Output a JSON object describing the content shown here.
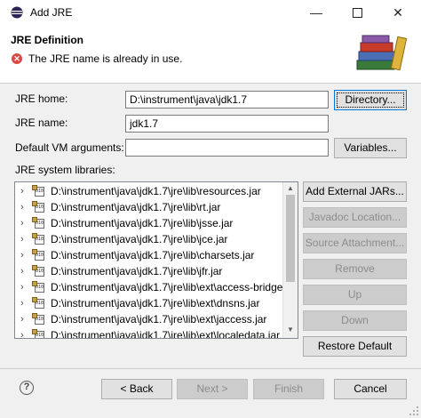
{
  "window": {
    "title": "Add JRE",
    "minimize_glyph": "—",
    "close_glyph": "✕"
  },
  "header": {
    "title": "JRE Definition",
    "message": "The JRE name is already in use.",
    "message_icon": "error-icon",
    "message_icon_glyph": "✕"
  },
  "form": {
    "jre_home_label": "JRE home:",
    "jre_home_value": "D:\\instrument\\java\\jdk1.7",
    "directory_button": "Directory...",
    "jre_name_label": "JRE name:",
    "jre_name_value": "jdk1.7",
    "vm_args_label": "Default VM arguments:",
    "vm_args_value": "",
    "variables_button": "Variables...",
    "libraries_label": "JRE system libraries:"
  },
  "libraries": {
    "items": [
      "D:\\instrument\\java\\jdk1.7\\jre\\lib\\resources.jar",
      "D:\\instrument\\java\\jdk1.7\\jre\\lib\\rt.jar",
      "D:\\instrument\\java\\jdk1.7\\jre\\lib\\jsse.jar",
      "D:\\instrument\\java\\jdk1.7\\jre\\lib\\jce.jar",
      "D:\\instrument\\java\\jdk1.7\\jre\\lib\\charsets.jar",
      "D:\\instrument\\java\\jdk1.7\\jre\\lib\\jfr.jar",
      "D:\\instrument\\java\\jdk1.7\\jre\\lib\\ext\\access-bridge",
      "D:\\instrument\\java\\jdk1.7\\jre\\lib\\ext\\dnsns.jar",
      "D:\\instrument\\java\\jdk1.7\\jre\\lib\\ext\\jaccess.jar",
      "D:\\instrument\\java\\jdk1.7\\jre\\lib\\ext\\localedata.jar"
    ],
    "jar_badge": "010",
    "expand_glyph": "›"
  },
  "side_buttons": {
    "add_external_jars": "Add External JARs...",
    "javadoc_location": "Javadoc Location...",
    "source_attachment": "Source Attachment...",
    "remove": "Remove",
    "up": "Up",
    "down": "Down",
    "restore_default": "Restore Default"
  },
  "footer": {
    "help_glyph": "?",
    "back": "< Back",
    "next": "Next >",
    "finish": "Finish",
    "cancel": "Cancel"
  },
  "colors": {
    "error": "#d9493f",
    "focus_border": "#0078d7",
    "disabled_text": "#8c8c8c"
  }
}
